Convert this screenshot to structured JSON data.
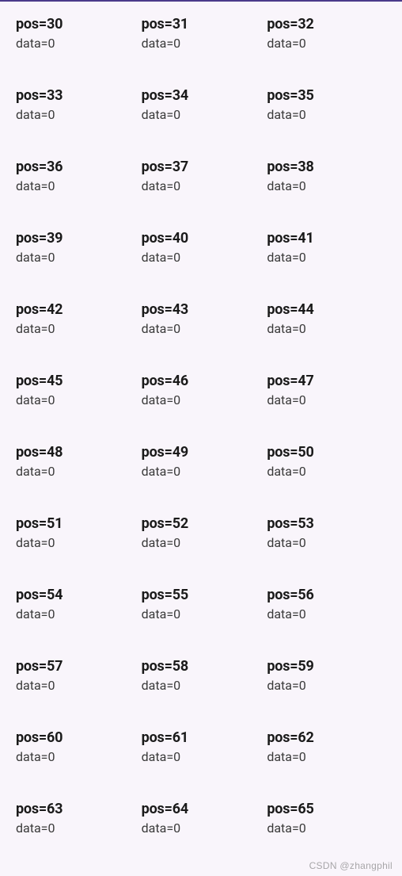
{
  "labels": {
    "posPrefix": "pos=",
    "dataPrefix": "data="
  },
  "cells": [
    {
      "pos": 30,
      "data": 0
    },
    {
      "pos": 31,
      "data": 0
    },
    {
      "pos": 32,
      "data": 0
    },
    {
      "pos": 33,
      "data": 0
    },
    {
      "pos": 34,
      "data": 0
    },
    {
      "pos": 35,
      "data": 0
    },
    {
      "pos": 36,
      "data": 0
    },
    {
      "pos": 37,
      "data": 0
    },
    {
      "pos": 38,
      "data": 0
    },
    {
      "pos": 39,
      "data": 0
    },
    {
      "pos": 40,
      "data": 0
    },
    {
      "pos": 41,
      "data": 0
    },
    {
      "pos": 42,
      "data": 0
    },
    {
      "pos": 43,
      "data": 0
    },
    {
      "pos": 44,
      "data": 0
    },
    {
      "pos": 45,
      "data": 0
    },
    {
      "pos": 46,
      "data": 0
    },
    {
      "pos": 47,
      "data": 0
    },
    {
      "pos": 48,
      "data": 0
    },
    {
      "pos": 49,
      "data": 0
    },
    {
      "pos": 50,
      "data": 0
    },
    {
      "pos": 51,
      "data": 0
    },
    {
      "pos": 52,
      "data": 0
    },
    {
      "pos": 53,
      "data": 0
    },
    {
      "pos": 54,
      "data": 0
    },
    {
      "pos": 55,
      "data": 0
    },
    {
      "pos": 56,
      "data": 0
    },
    {
      "pos": 57,
      "data": 0
    },
    {
      "pos": 58,
      "data": 0
    },
    {
      "pos": 59,
      "data": 0
    },
    {
      "pos": 60,
      "data": 0
    },
    {
      "pos": 61,
      "data": 0
    },
    {
      "pos": 62,
      "data": 0
    },
    {
      "pos": 63,
      "data": 0
    },
    {
      "pos": 64,
      "data": 0
    },
    {
      "pos": 65,
      "data": 0
    }
  ],
  "watermark": "CSDN @zhangphil"
}
